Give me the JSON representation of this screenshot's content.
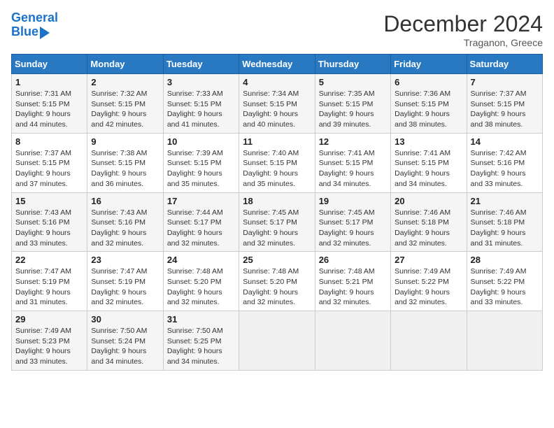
{
  "header": {
    "logo_line1": "General",
    "logo_line2": "Blue",
    "month": "December 2024",
    "location": "Traganon, Greece"
  },
  "days_of_week": [
    "Sunday",
    "Monday",
    "Tuesday",
    "Wednesday",
    "Thursday",
    "Friday",
    "Saturday"
  ],
  "weeks": [
    [
      {
        "day": 1,
        "sunrise": "7:31 AM",
        "sunset": "5:15 PM",
        "daylight": "9 hours and 44 minutes."
      },
      {
        "day": 2,
        "sunrise": "7:32 AM",
        "sunset": "5:15 PM",
        "daylight": "9 hours and 42 minutes."
      },
      {
        "day": 3,
        "sunrise": "7:33 AM",
        "sunset": "5:15 PM",
        "daylight": "9 hours and 41 minutes."
      },
      {
        "day": 4,
        "sunrise": "7:34 AM",
        "sunset": "5:15 PM",
        "daylight": "9 hours and 40 minutes."
      },
      {
        "day": 5,
        "sunrise": "7:35 AM",
        "sunset": "5:15 PM",
        "daylight": "9 hours and 39 minutes."
      },
      {
        "day": 6,
        "sunrise": "7:36 AM",
        "sunset": "5:15 PM",
        "daylight": "9 hours and 38 minutes."
      },
      {
        "day": 7,
        "sunrise": "7:37 AM",
        "sunset": "5:15 PM",
        "daylight": "9 hours and 38 minutes."
      }
    ],
    [
      {
        "day": 8,
        "sunrise": "7:37 AM",
        "sunset": "5:15 PM",
        "daylight": "9 hours and 37 minutes."
      },
      {
        "day": 9,
        "sunrise": "7:38 AM",
        "sunset": "5:15 PM",
        "daylight": "9 hours and 36 minutes."
      },
      {
        "day": 10,
        "sunrise": "7:39 AM",
        "sunset": "5:15 PM",
        "daylight": "9 hours and 35 minutes."
      },
      {
        "day": 11,
        "sunrise": "7:40 AM",
        "sunset": "5:15 PM",
        "daylight": "9 hours and 35 minutes."
      },
      {
        "day": 12,
        "sunrise": "7:41 AM",
        "sunset": "5:15 PM",
        "daylight": "9 hours and 34 minutes."
      },
      {
        "day": 13,
        "sunrise": "7:41 AM",
        "sunset": "5:15 PM",
        "daylight": "9 hours and 34 minutes."
      },
      {
        "day": 14,
        "sunrise": "7:42 AM",
        "sunset": "5:16 PM",
        "daylight": "9 hours and 33 minutes."
      }
    ],
    [
      {
        "day": 15,
        "sunrise": "7:43 AM",
        "sunset": "5:16 PM",
        "daylight": "9 hours and 33 minutes."
      },
      {
        "day": 16,
        "sunrise": "7:43 AM",
        "sunset": "5:16 PM",
        "daylight": "9 hours and 32 minutes."
      },
      {
        "day": 17,
        "sunrise": "7:44 AM",
        "sunset": "5:17 PM",
        "daylight": "9 hours and 32 minutes."
      },
      {
        "day": 18,
        "sunrise": "7:45 AM",
        "sunset": "5:17 PM",
        "daylight": "9 hours and 32 minutes."
      },
      {
        "day": 19,
        "sunrise": "7:45 AM",
        "sunset": "5:17 PM",
        "daylight": "9 hours and 32 minutes."
      },
      {
        "day": 20,
        "sunrise": "7:46 AM",
        "sunset": "5:18 PM",
        "daylight": "9 hours and 32 minutes."
      },
      {
        "day": 21,
        "sunrise": "7:46 AM",
        "sunset": "5:18 PM",
        "daylight": "9 hours and 31 minutes."
      }
    ],
    [
      {
        "day": 22,
        "sunrise": "7:47 AM",
        "sunset": "5:19 PM",
        "daylight": "9 hours and 31 minutes."
      },
      {
        "day": 23,
        "sunrise": "7:47 AM",
        "sunset": "5:19 PM",
        "daylight": "9 hours and 32 minutes."
      },
      {
        "day": 24,
        "sunrise": "7:48 AM",
        "sunset": "5:20 PM",
        "daylight": "9 hours and 32 minutes."
      },
      {
        "day": 25,
        "sunrise": "7:48 AM",
        "sunset": "5:20 PM",
        "daylight": "9 hours and 32 minutes."
      },
      {
        "day": 26,
        "sunrise": "7:48 AM",
        "sunset": "5:21 PM",
        "daylight": "9 hours and 32 minutes."
      },
      {
        "day": 27,
        "sunrise": "7:49 AM",
        "sunset": "5:22 PM",
        "daylight": "9 hours and 32 minutes."
      },
      {
        "day": 28,
        "sunrise": "7:49 AM",
        "sunset": "5:22 PM",
        "daylight": "9 hours and 33 minutes."
      }
    ],
    [
      {
        "day": 29,
        "sunrise": "7:49 AM",
        "sunset": "5:23 PM",
        "daylight": "9 hours and 33 minutes."
      },
      {
        "day": 30,
        "sunrise": "7:50 AM",
        "sunset": "5:24 PM",
        "daylight": "9 hours and 34 minutes."
      },
      {
        "day": 31,
        "sunrise": "7:50 AM",
        "sunset": "5:25 PM",
        "daylight": "9 hours and 34 minutes."
      },
      null,
      null,
      null,
      null
    ]
  ]
}
